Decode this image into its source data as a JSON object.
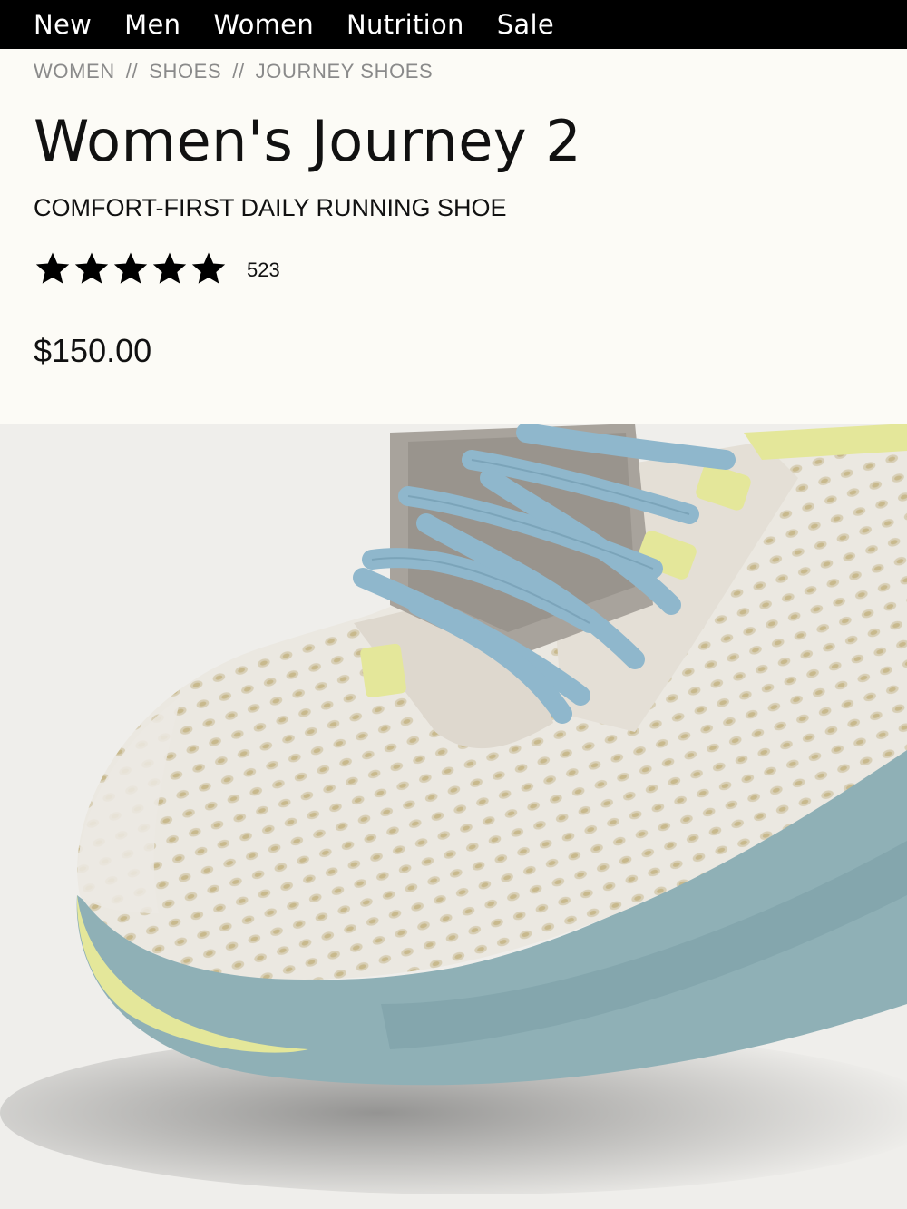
{
  "nav": {
    "items": [
      "New",
      "Men",
      "Women",
      "Nutrition",
      "Sale"
    ]
  },
  "breadcrumb": {
    "items": [
      "WOMEN",
      "SHOES",
      "JOURNEY SHOES"
    ],
    "separator": "//"
  },
  "product": {
    "title": "Women's Journey 2",
    "subtitle": "COMFORT-FIRST DAILY RUNNING SHOE",
    "rating": {
      "stars": 5,
      "max": 5,
      "count": "523"
    },
    "price": "$150.00"
  },
  "image": {
    "subject": "shoe-photo",
    "colors": {
      "upper": "#ece9e3",
      "sole": "#8fb0b6",
      "accent": "#e4e79a",
      "laces": "#8fb7cc"
    }
  }
}
